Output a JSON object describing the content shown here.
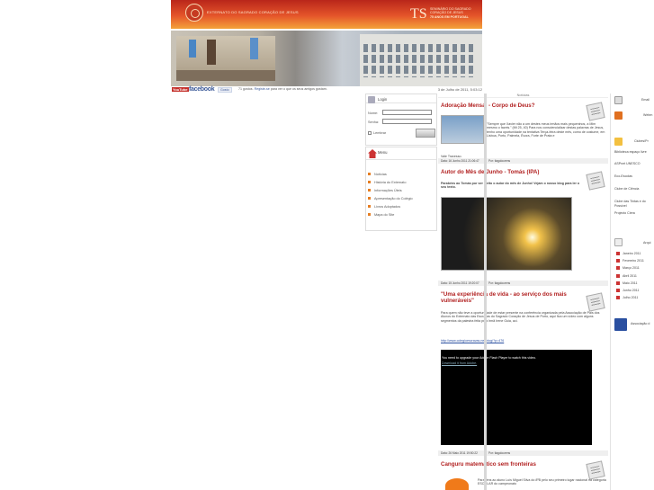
{
  "header": {
    "school_name": "EXTERNATO DO SAGRADO CORAÇÃO DE JESUS",
    "logo_text": "TS",
    "seminary_line1": "SEMINÁRIO DO SAGRADO",
    "seminary_line2": "CORAÇÃO DE JESUS",
    "seminary_line3": "75 ANOS EM PORTUGAL"
  },
  "social": {
    "youtube": "YouTube",
    "facebook": "facebook",
    "like_button": "Gosto",
    "likes_count": "71 gostos.",
    "likes_link": "Registe-se",
    "likes_text": "para ver o que os seus amigos gostam.",
    "date": "3 de Julho de 2011, 5:03:12"
  },
  "login": {
    "title": "Login",
    "name_label": "Nome:",
    "password_label": "Senha:",
    "remember_label": "Lembrar"
  },
  "menu": {
    "title": "Menu",
    "items": [
      "Notícias",
      "História do Externato",
      "Informações Úteis",
      "Apresentação do Colégio",
      "Livros Adoptados",
      "Mapa do Site"
    ]
  },
  "news": {
    "section_title": "Notícias",
    "articles": [
      {
        "title": "Adoração Mensal - Corpo de Deus?",
        "text": "\"Sempre que Xavier não a um destes meus irmãos mais pequeninos, a Mim mesmo o fazeis.\" (Mt 25, 40) Para nos consciencializar destas palavras de Jesus, tenho uma oportunidade na tentativa Terça-feira deste mês, como de costume, em Lisboa, Porto, Palmela, Évora, Forte de Prata e",
        "extra": "Vale Travesso.",
        "date": "Data: 16 Junho 2011 21:06:47",
        "author": "Por: tiagolourens"
      },
      {
        "title": "Autor do Mês de Junho - Tomás (IPA)",
        "text": "Parabéns ao Tomás por ser eleito o autor do mês de Junho! Vejam o nosso blog para ler o seu texto.",
        "date": "Data: 15 Junho 2011 19:20:07",
        "author": "Por: tiagolourens"
      },
      {
        "title": "\"Uma experiência de vida - ao serviço dos mais vulneráveis\"",
        "text": "Para quem não teve a oportunidade de estar presente na conferência organizada pela Associação de Pais dos Alunos do Externato das Escravas do Sagrado Coração de Jesus de Porto, aqui fica um vídeo com alguns segmentos da palestra feita pela Irmã Irene Guia, aci.",
        "link": "http://www.colegioescravas.net/blog/?p=476",
        "video_msg": "You need to upgrade your Adobe Flash Player to watch this video.",
        "video_link": "Download it from Adobe.",
        "date": "Data: 26 Maio 2011 19:50:22",
        "author": "Por: tiagolourens"
      },
      {
        "title": "Canguru matemático sem fronteiras",
        "text": "Parabéns ao aluno Luís Miguel Silva do 8ºB pelo seu primeiro lugar nacional na categoria ESCOLAR do campeonato"
      }
    ]
  },
  "right": {
    "email": "Email",
    "webmail": "Webm",
    "clubs_title": "Clubes/Pr",
    "links": [
      "Biblioteca espaço livre",
      "ASPnet UNESCO",
      "Eco-Escolas",
      "Clube de Ciência",
      "Clube das Tintas e do Possível",
      "Projecto Ciera"
    ],
    "archive_title": "Arqui",
    "archive": [
      "Janeiro 2011",
      "Fevereiro 2011",
      "Março 2011",
      "Abril 2011",
      "Maio 2011",
      "Junho 2011",
      "Julho 2011"
    ],
    "association": "Associação d"
  }
}
